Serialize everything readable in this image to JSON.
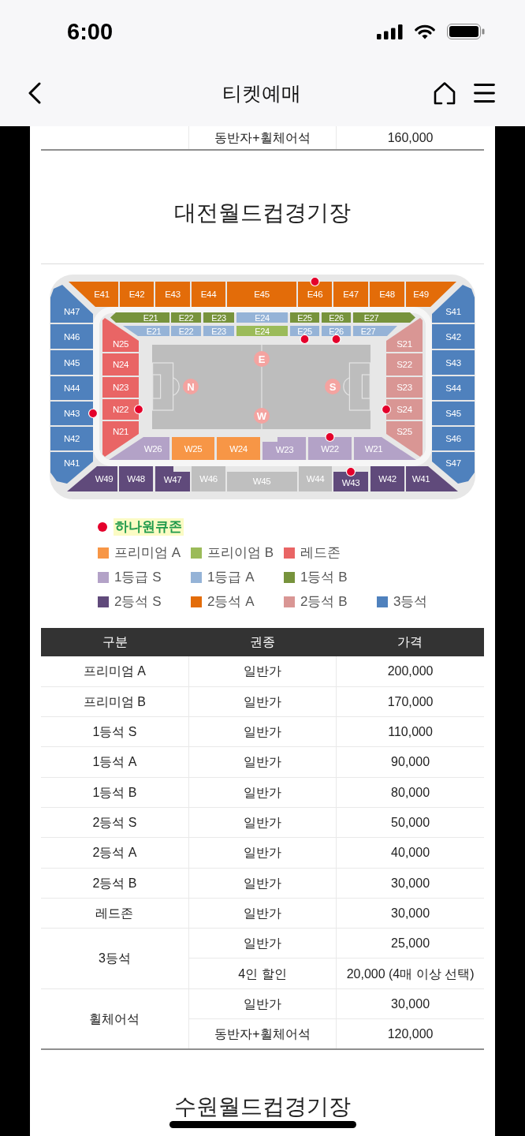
{
  "status_bar": {
    "time": "6:00"
  },
  "nav": {
    "title": "티켓예매"
  },
  "previous_table_tail": {
    "rows": [
      {
        "ticket_type": "동반자+휠체어석",
        "price": "160,000"
      }
    ]
  },
  "stadiums": [
    {
      "name": "대전월드컵경기장",
      "seat_map": {
        "stands": [
          {
            "kind": "east_outer",
            "blocks": [
              {
                "label": "E41",
                "color": "#e36c09",
                "hana_zone": false
              },
              {
                "label": "E42",
                "color": "#e36c09",
                "hana_zone": false
              },
              {
                "label": "E43",
                "color": "#e36c09",
                "hana_zone": false
              },
              {
                "label": "E44",
                "color": "#e36c09",
                "hana_zone": false
              },
              {
                "label": "E45",
                "color": "#e36c09",
                "hana_zone": false
              },
              {
                "label": "E46",
                "color": "#e36c09",
                "hana_zone": true
              },
              {
                "label": "E47",
                "color": "#e36c09",
                "hana_zone": false
              },
              {
                "label": "E48",
                "color": "#e36c09",
                "hana_zone": false
              },
              {
                "label": "E49",
                "color": "#e36c09",
                "hana_zone": false
              }
            ]
          },
          {
            "kind": "east_inner_upper",
            "blocks": [
              {
                "label": "E21",
                "color": "#77933c",
                "hana_zone": false
              },
              {
                "label": "E22",
                "color": "#77933c",
                "hana_zone": false
              },
              {
                "label": "E23",
                "color": "#77933c",
                "hana_zone": false
              },
              {
                "label": "E24",
                "color": "#95b3d7",
                "hana_zone": false
              },
              {
                "label": "E25",
                "color": "#77933c",
                "hana_zone": false
              },
              {
                "label": "E26",
                "color": "#77933c",
                "hana_zone": false
              },
              {
                "label": "E27",
                "color": "#77933c",
                "hana_zone": false
              }
            ]
          },
          {
            "kind": "east_inner_lower",
            "blocks": [
              {
                "label": "E21",
                "color": "#95b3d7",
                "hana_zone": false
              },
              {
                "label": "E22",
                "color": "#95b3d7",
                "hana_zone": false
              },
              {
                "label": "E23",
                "color": "#95b3d7",
                "hana_zone": false
              },
              {
                "label": "E24",
                "color": "#9bbb59",
                "hana_zone": false
              },
              {
                "label": "E25",
                "color": "#95b3d7",
                "hana_zone": true
              },
              {
                "label": "E26",
                "color": "#95b3d7",
                "hana_zone": true
              },
              {
                "label": "E27",
                "color": "#95b3d7",
                "hana_zone": false
              }
            ]
          },
          {
            "kind": "north_outer",
            "blocks": [
              {
                "label": "N47",
                "color": "#4f81bd",
                "hana_zone": false
              },
              {
                "label": "N46",
                "color": "#4f81bd",
                "hana_zone": false
              },
              {
                "label": "N45",
                "color": "#4f81bd",
                "hana_zone": false
              },
              {
                "label": "N44",
                "color": "#4f81bd",
                "hana_zone": false
              },
              {
                "label": "N43",
                "color": "#4f81bd",
                "hana_zone": true
              },
              {
                "label": "N42",
                "color": "#4f81bd",
                "hana_zone": false
              },
              {
                "label": "N41",
                "color": "#4f81bd",
                "hana_zone": false
              }
            ]
          },
          {
            "kind": "north_inner",
            "blocks": [
              {
                "label": "N25",
                "color": "#e96565",
                "hana_zone": false
              },
              {
                "label": "N24",
                "color": "#e96565",
                "hana_zone": false
              },
              {
                "label": "N23",
                "color": "#e96565",
                "hana_zone": false
              },
              {
                "label": "N22",
                "color": "#e96565",
                "hana_zone": true
              },
              {
                "label": "N21",
                "color": "#e96565",
                "hana_zone": false
              }
            ]
          },
          {
            "kind": "south_inner",
            "blocks": [
              {
                "label": "S21",
                "color": "#d99694",
                "hana_zone": false
              },
              {
                "label": "S22",
                "color": "#d99694",
                "hana_zone": false
              },
              {
                "label": "S23",
                "color": "#d99694",
                "hana_zone": false
              },
              {
                "label": "S24",
                "color": "#d99694",
                "hana_zone": true
              },
              {
                "label": "S25",
                "color": "#d99694",
                "hana_zone": false
              }
            ]
          },
          {
            "kind": "south_outer",
            "blocks": [
              {
                "label": "S41",
                "color": "#4f81bd",
                "hana_zone": false
              },
              {
                "label": "S42",
                "color": "#4f81bd",
                "hana_zone": false
              },
              {
                "label": "S43",
                "color": "#4f81bd",
                "hana_zone": false
              },
              {
                "label": "S44",
                "color": "#4f81bd",
                "hana_zone": false
              },
              {
                "label": "S45",
                "color": "#4f81bd",
                "hana_zone": false
              },
              {
                "label": "S46",
                "color": "#4f81bd",
                "hana_zone": false
              },
              {
                "label": "S47",
                "color": "#4f81bd",
                "hana_zone": false
              }
            ]
          },
          {
            "kind": "west_inner",
            "blocks": [
              {
                "label": "W26",
                "color": "#b3a2c7",
                "hana_zone": false
              },
              {
                "label": "W25",
                "color": "#f79646",
                "hana_zone": false
              },
              {
                "label": "W24",
                "color": "#f79646",
                "hana_zone": false
              },
              {
                "label": "W23",
                "color": "#b3a2c7",
                "hana_zone": false
              },
              {
                "label": "W22",
                "color": "#b3a2c7",
                "hana_zone": true
              },
              {
                "label": "W21",
                "color": "#b3a2c7",
                "hana_zone": false
              }
            ]
          },
          {
            "kind": "west_outer",
            "blocks": [
              {
                "label": "W49",
                "color": "#604a7b",
                "hana_zone": false
              },
              {
                "label": "W48",
                "color": "#604a7b",
                "hana_zone": false
              },
              {
                "label": "W47",
                "color": "#604a7b",
                "hana_zone": false
              },
              {
                "label": "W46",
                "color": "#bfbfbf",
                "hana_zone": false
              },
              {
                "label": "W45",
                "color": "#bfbfbf",
                "hana_zone": false
              },
              {
                "label": "W44",
                "color": "#bfbfbf",
                "hana_zone": false
              },
              {
                "label": "W43",
                "color": "#604a7b",
                "hana_zone": true
              },
              {
                "label": "W42",
                "color": "#604a7b",
                "hana_zone": false
              },
              {
                "label": "W41",
                "color": "#604a7b",
                "hana_zone": false
              }
            ]
          }
        ],
        "pitch_markers": [
          "E",
          "N",
          "S",
          "W"
        ]
      },
      "legend": {
        "hana_zone": {
          "label": "하나원큐존",
          "color": "#e4002b"
        },
        "rows": [
          [
            {
              "label": "프리미엄 A",
              "color": "#f79646"
            },
            {
              "label": "프리이엄 B",
              "color": "#9bbb59"
            },
            {
              "label": "레드존",
              "color": "#e96565"
            }
          ],
          [
            {
              "label": "1등급 S",
              "color": "#b3a2c7"
            },
            {
              "label": "1등급 A",
              "color": "#95b3d7"
            },
            {
              "label": "1등석 B",
              "color": "#77933c"
            }
          ],
          [
            {
              "label": "2등석 S",
              "color": "#604a7b"
            },
            {
              "label": "2등석 A",
              "color": "#e36c09"
            },
            {
              "label": "2등석 B",
              "color": "#d99694"
            },
            {
              "label": "3등석",
              "color": "#4f81bd"
            }
          ]
        ]
      },
      "price_table": {
        "columns": [
          "구분",
          "권종",
          "가격"
        ],
        "groups": [
          {
            "category": "프리미엄 A",
            "tickets": [
              {
                "type": "일반가",
                "price": "200,000"
              }
            ]
          },
          {
            "category": "프리미엄 B",
            "tickets": [
              {
                "type": "일반가",
                "price": "170,000"
              }
            ]
          },
          {
            "category": "1등석 S",
            "tickets": [
              {
                "type": "일반가",
                "price": "110,000"
              }
            ]
          },
          {
            "category": "1등석 A",
            "tickets": [
              {
                "type": "일반가",
                "price": "90,000"
              }
            ]
          },
          {
            "category": "1등석 B",
            "tickets": [
              {
                "type": "일반가",
                "price": "80,000"
              }
            ]
          },
          {
            "category": "2등석 S",
            "tickets": [
              {
                "type": "일반가",
                "price": "50,000"
              }
            ]
          },
          {
            "category": "2등석 A",
            "tickets": [
              {
                "type": "일반가",
                "price": "40,000"
              }
            ]
          },
          {
            "category": "2등석 B",
            "tickets": [
              {
                "type": "일반가",
                "price": "30,000"
              }
            ]
          },
          {
            "category": "레드존",
            "tickets": [
              {
                "type": "일반가",
                "price": "30,000"
              }
            ]
          },
          {
            "category": "3등석",
            "tickets": [
              {
                "type": "일반가",
                "price": "25,000"
              },
              {
                "type": "4인 할인",
                "price": "20,000 (4매 이상 선택)"
              }
            ]
          },
          {
            "category": "휠체어석",
            "tickets": [
              {
                "type": "일반가",
                "price": "30,000"
              },
              {
                "type": "동반자+휠체어석",
                "price": "120,000"
              }
            ]
          }
        ]
      }
    },
    {
      "name": "수원월드컵경기장"
    }
  ]
}
